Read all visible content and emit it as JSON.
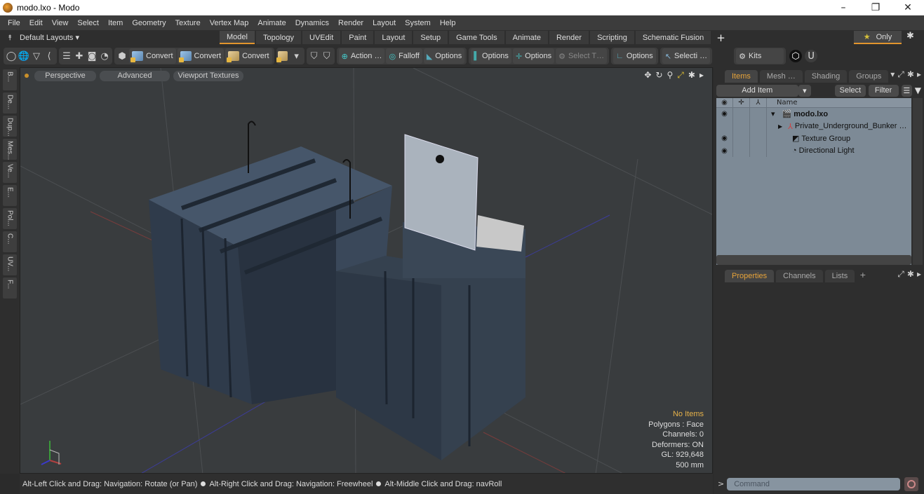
{
  "window": {
    "title": "modo.lxo - Modo",
    "controls": {
      "minimize": "–",
      "restore": "❐",
      "close": "✕"
    }
  },
  "menu": [
    "File",
    "Edit",
    "View",
    "Select",
    "Item",
    "Geometry",
    "Texture",
    "Vertex Map",
    "Animate",
    "Dynamics",
    "Render",
    "Layout",
    "System",
    "Help"
  ],
  "layouts": {
    "preset_label": "Default Layouts ▾",
    "tabs": [
      "Model",
      "Topology",
      "UVEdit",
      "Paint",
      "Layout",
      "Setup",
      "Game Tools",
      "Animate",
      "Render",
      "Scripting",
      "Schematic Fusion"
    ],
    "active_tab": "Model",
    "add_tab": "+",
    "only_label": "Only"
  },
  "toolbar": {
    "convert1": "Convert",
    "convert2": "Convert",
    "convert3": "Convert",
    "action": "Action …",
    "falloff": "Falloff",
    "options1": "Options",
    "options2": "Options",
    "options3": "Options",
    "select_t": "Select T…",
    "options4": "Options",
    "selecti": "Selecti …",
    "kits": "Kits"
  },
  "left_tabs": [
    "B...",
    "De...",
    "Dup...",
    "Mes...",
    "Ve...",
    "E...",
    "Pol...",
    "C...",
    "UV...",
    "F..."
  ],
  "viewport": {
    "view_mode": "Perspective",
    "shading": "Advanced",
    "textures": "Viewport Textures",
    "stats": {
      "selection": "No Items",
      "polygons": "Polygons : Face",
      "channels": "Channels: 0",
      "deformers": "Deformers: ON",
      "gl": "GL: 929,648",
      "grid": "500 mm"
    }
  },
  "status": {
    "hint1": "Alt-Left Click and Drag: Navigation: Rotate (or Pan)",
    "hint2": "Alt-Right Click and Drag: Navigation: Freewheel",
    "hint3": "Alt-Middle Click and Drag: navRoll"
  },
  "items_panel": {
    "tabs": [
      "Items",
      "Mesh …",
      "Shading",
      "Groups"
    ],
    "active_tab": "Items",
    "add_item": "Add Item",
    "select": "Select",
    "filter": "Filter",
    "column_name": "Name",
    "tree": [
      {
        "label": "modo.lxo",
        "visible": true,
        "level": 0,
        "expanded": true
      },
      {
        "label": "Private_Underground_Bunker …",
        "visible": false,
        "level": 1,
        "expanded": false
      },
      {
        "label": "Texture Group",
        "visible": true,
        "level": 1
      },
      {
        "label": "Directional Light",
        "visible": true,
        "level": 1
      }
    ]
  },
  "properties_panel": {
    "tabs": [
      "Properties",
      "Channels",
      "Lists"
    ],
    "active_tab": "Properties",
    "add_tab": "+"
  },
  "command": {
    "placeholder": "Command",
    "prompt": ">"
  },
  "colors": {
    "accent": "#e2952d",
    "highlight_text": "#e6b24a"
  }
}
